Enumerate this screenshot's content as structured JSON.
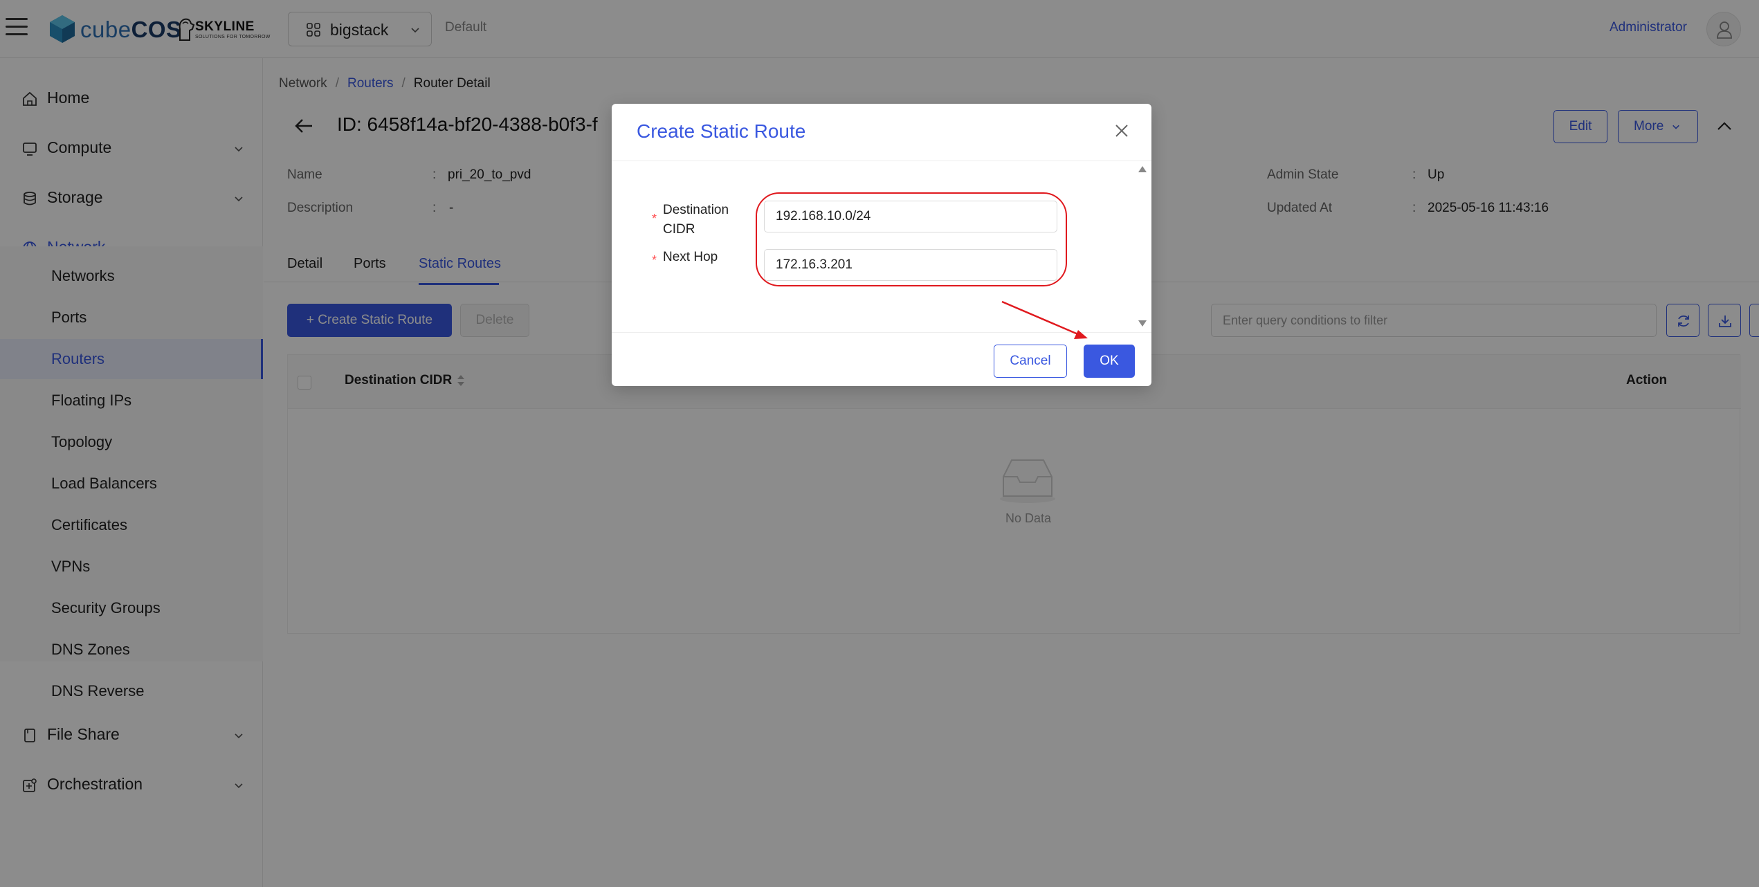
{
  "header": {
    "brand_prefix": "cube",
    "brand_suffix": "COS",
    "partner": "SKYLINE",
    "partner_sub": "SOLUTIONS FOR TOMORROW",
    "project": "bigstack",
    "domain": "Default",
    "user": "Administrator"
  },
  "sidebar": {
    "items": [
      {
        "label": "Home"
      },
      {
        "label": "Compute"
      },
      {
        "label": "Storage"
      },
      {
        "label": "Network"
      },
      {
        "label": "File Share"
      },
      {
        "label": "Orchestration"
      }
    ],
    "network_sub": [
      {
        "label": "Networks"
      },
      {
        "label": "Ports"
      },
      {
        "label": "Routers"
      },
      {
        "label": "Floating IPs"
      },
      {
        "label": "Topology"
      },
      {
        "label": "Load Balancers"
      },
      {
        "label": "Certificates"
      },
      {
        "label": "VPNs"
      },
      {
        "label": "Security Groups"
      },
      {
        "label": "DNS Zones"
      },
      {
        "label": "DNS Reverse"
      }
    ]
  },
  "breadcrumb": {
    "root": "Network",
    "sep": "/",
    "parent": "Routers",
    "current": "Router Detail"
  },
  "detail": {
    "title": "ID:  6458f14a-bf20-4388-b0f3-f",
    "edit": "Edit",
    "more": "More",
    "fields": {
      "name_label": "Name",
      "name_value": "pri_20_to_pvd",
      "desc_label": "Description",
      "desc_value": "-",
      "admin_label": "Admin State",
      "admin_value": "Up",
      "updated_label": "Updated At",
      "updated_value": "2025-05-16 11:43:16",
      "colon": ":"
    }
  },
  "tabs": [
    {
      "label": "Detail"
    },
    {
      "label": "Ports"
    },
    {
      "label": "Static Routes"
    }
  ],
  "toolbar": {
    "create": "+ Create Static Route",
    "delete": "Delete",
    "filter_placeholder": "Enter query conditions to filter"
  },
  "table": {
    "col_dest": "Destination CIDR",
    "col_action": "Action",
    "empty": "No Data"
  },
  "modal": {
    "title": "Create Static Route",
    "dest_label_1": "Destination",
    "dest_label_2": "CIDR",
    "dest_value": "192.168.10.0/24",
    "next_label": "Next Hop",
    "next_value": "172.16.3.201",
    "required_mark": "*",
    "cancel": "Cancel",
    "ok": "OK"
  },
  "colors": {
    "accent": "#3a58e0",
    "annotation": "#e0191e"
  }
}
